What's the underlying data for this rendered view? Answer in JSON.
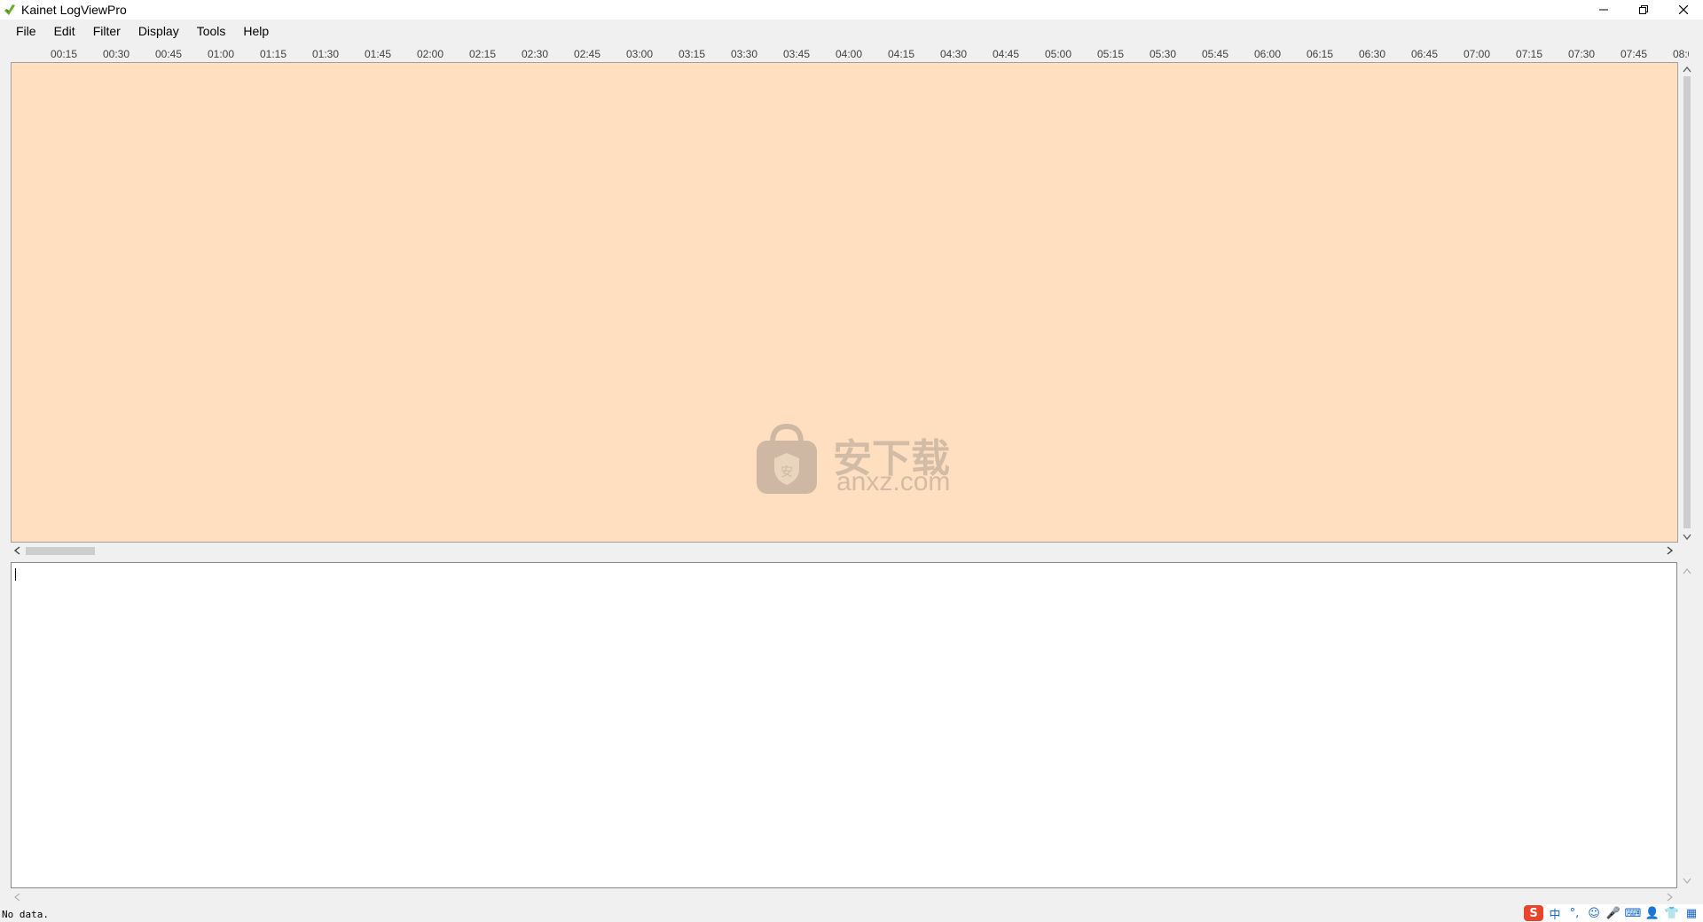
{
  "window": {
    "title": "Kainet LogViewPro",
    "controls": [
      "minimize",
      "restore",
      "close"
    ]
  },
  "menu": [
    "File",
    "Edit",
    "Filter",
    "Display",
    "Tools",
    "Help"
  ],
  "ruler": {
    "ticks": [
      "00:15",
      "00:30",
      "00:45",
      "01:00",
      "01:15",
      "01:30",
      "01:45",
      "02:00",
      "02:15",
      "02:30",
      "02:45",
      "03:00",
      "03:15",
      "03:30",
      "03:45",
      "04:00",
      "04:15",
      "04:30",
      "04:45",
      "05:00",
      "05:15",
      "05:30",
      "05:45",
      "06:00",
      "06:15",
      "06:30",
      "06:45",
      "07:00",
      "07:15",
      "07:30",
      "07:45",
      "08:0"
    ]
  },
  "timeline": {
    "background": "#ffdfc0"
  },
  "watermark": {
    "cjk": "安下载",
    "text": "anxz.com"
  },
  "log": {
    "content": ""
  },
  "status": {
    "text": "No data."
  },
  "tray": {
    "brand_color": "#e8452c",
    "icons": [
      {
        "name": "ime-logo-icon",
        "glyph": "S"
      },
      {
        "name": "ime-chinese-icon",
        "glyph": "中"
      },
      {
        "name": "punctuation-icon",
        "glyph": "°,"
      },
      {
        "name": "emoji-icon",
        "glyph": "☺"
      },
      {
        "name": "microphone-icon",
        "glyph": "🎤"
      },
      {
        "name": "keyboard-icon",
        "glyph": "⌨"
      },
      {
        "name": "user-icon",
        "glyph": "👤"
      },
      {
        "name": "shirt-icon",
        "glyph": "👕"
      },
      {
        "name": "grid-icon",
        "glyph": "▦"
      }
    ]
  }
}
